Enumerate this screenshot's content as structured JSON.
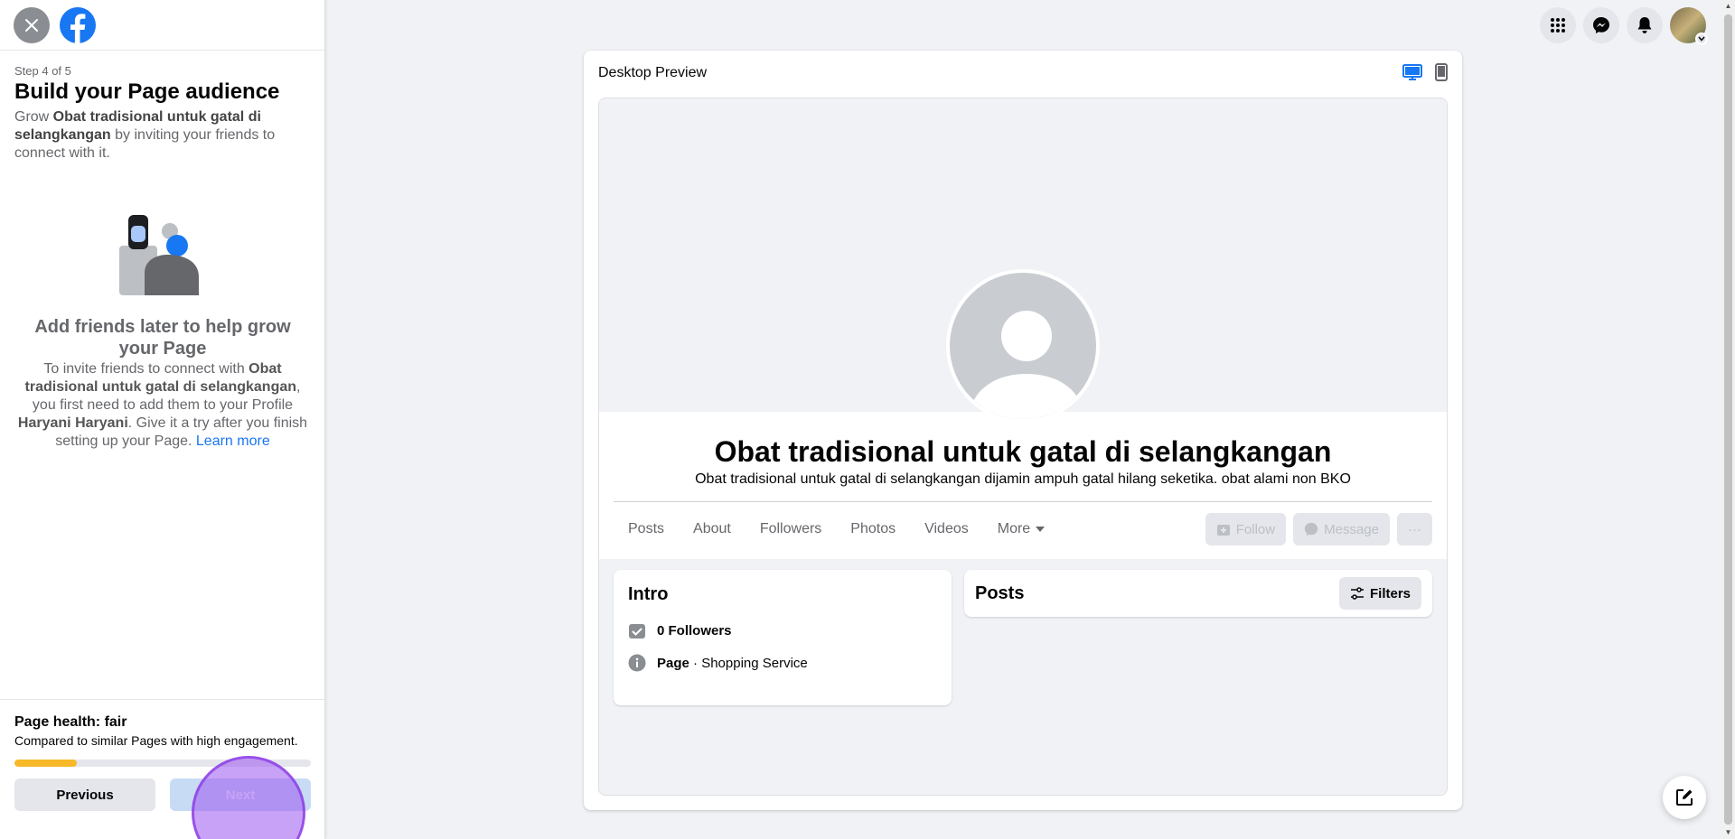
{
  "sidebar": {
    "step_label": "Step 4 of 5",
    "title": "Build your Page audience",
    "desc_prefix": "Grow ",
    "page_name": "Obat tradisional untuk gatal di selangkangan",
    "desc_suffix": " by inviting your friends to connect with it.",
    "info_title": "Add friends later to help grow your Page",
    "info_text_1": "To invite friends to connect with ",
    "info_text_2": ", you first need to add them to your Profile ",
    "profile_name": "Haryani Haryani",
    "info_text_3": ". Give it a try after you finish setting up your Page. ",
    "learn_more": "Learn more",
    "health_title": "Page health: fair",
    "health_desc": "Compared to similar Pages with high engagement.",
    "health_progress": 0.21,
    "previous_label": "Previous",
    "next_label": "Next"
  },
  "topbar": {
    "icons": [
      "menu-grid-icon",
      "messenger-icon",
      "bell-icon",
      "avatar"
    ]
  },
  "preview": {
    "title": "Desktop Preview",
    "page_name": "Obat tradisional untuk gatal di selangkangan",
    "page_desc": "Obat tradisional untuk gatal di selangkangan dijamin ampuh gatal hilang seketika. obat alami non BKO",
    "tabs": [
      "Posts",
      "About",
      "Followers",
      "Photos",
      "Videos",
      "More"
    ],
    "follow_label": "Follow",
    "message_label": "Message",
    "more_label": "···",
    "intro_title": "Intro",
    "followers_text": "0 Followers",
    "page_type_bold": "Page",
    "page_type_rest": " · Shopping Service",
    "posts_title": "Posts",
    "filters_label": "Filters"
  },
  "colors": {
    "brand": "#1877f2",
    "health": "#f7b928",
    "click_indicator": "#9b55ee"
  }
}
